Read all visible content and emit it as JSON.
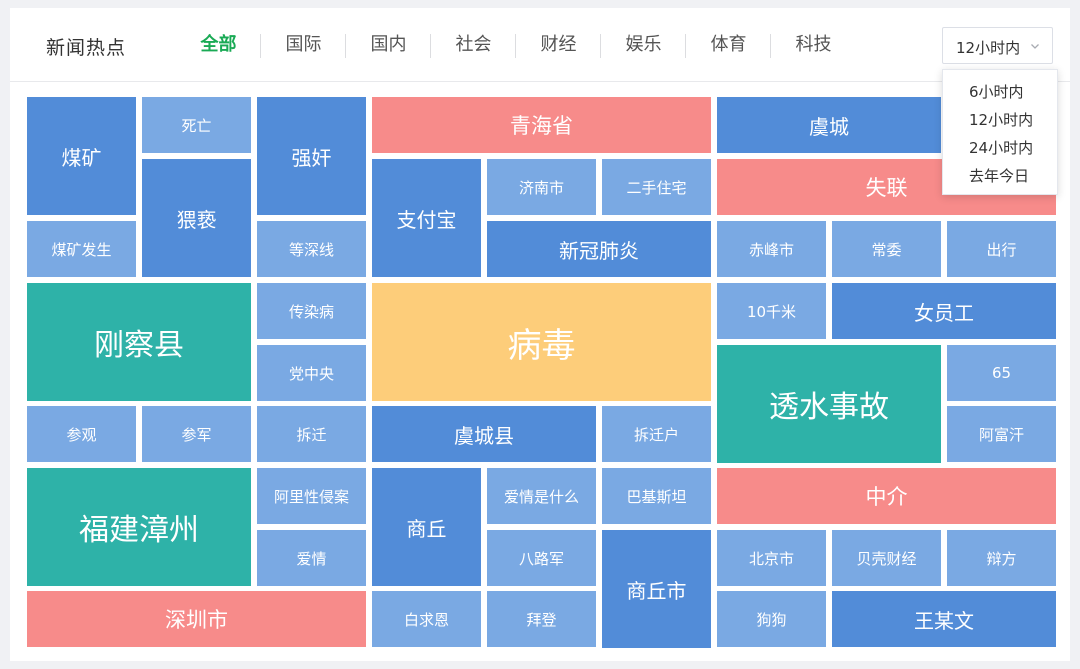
{
  "header": {
    "title": "新闻热点"
  },
  "tabs": [
    {
      "label": "全部",
      "active": true
    },
    {
      "label": "国际",
      "active": false
    },
    {
      "label": "国内",
      "active": false
    },
    {
      "label": "社会",
      "active": false
    },
    {
      "label": "财经",
      "active": false
    },
    {
      "label": "娱乐",
      "active": false
    },
    {
      "label": "体育",
      "active": false
    },
    {
      "label": "科技",
      "active": false
    }
  ],
  "time_filter": {
    "selected": "12小时内",
    "icon": "chevron-down-icon",
    "options": [
      "6小时内",
      "12小时内",
      "24小时内",
      "去年今日"
    ],
    "open": true
  },
  "colors": {
    "active_tab": "#1aaa55",
    "level_small": "#7aa9e3",
    "level_medium": "#528cd8",
    "level_large": "#2eb2a8",
    "level_hot": "#f78b8a",
    "level_top": "#fdcd7a"
  },
  "treemap": [
    {
      "label": "煤矿",
      "level": "medium"
    },
    {
      "label": "死亡",
      "level": "small"
    },
    {
      "label": "猥亵",
      "level": "medium"
    },
    {
      "label": "煤矿发生",
      "level": "small"
    },
    {
      "label": "强奸",
      "level": "medium"
    },
    {
      "label": "等深线",
      "level": "small"
    },
    {
      "label": "青海省",
      "level": "hot"
    },
    {
      "label": "支付宝",
      "level": "medium"
    },
    {
      "label": "济南市",
      "level": "small"
    },
    {
      "label": "二手住宅",
      "level": "small"
    },
    {
      "label": "新冠肺炎",
      "level": "medium"
    },
    {
      "label": "虞城",
      "level": "medium"
    },
    {
      "label": "失联",
      "level": "hot"
    },
    {
      "label": "赤峰市",
      "level": "small"
    },
    {
      "label": "常委",
      "level": "small"
    },
    {
      "label": "出行",
      "level": "small"
    },
    {
      "label": "刚察县",
      "level": "large"
    },
    {
      "label": "传染病",
      "level": "small"
    },
    {
      "label": "党中央",
      "level": "small"
    },
    {
      "label": "病毒",
      "level": "top"
    },
    {
      "label": "10千米",
      "level": "small"
    },
    {
      "label": "女员工",
      "level": "medium"
    },
    {
      "label": "透水事故",
      "level": "large"
    },
    {
      "label": "65",
      "level": "small"
    },
    {
      "label": "参观",
      "level": "small"
    },
    {
      "label": "参军",
      "level": "small"
    },
    {
      "label": "拆迁",
      "level": "small"
    },
    {
      "label": "虞城县",
      "level": "medium"
    },
    {
      "label": "拆迁户",
      "level": "small"
    },
    {
      "label": "阿富汗",
      "level": "small"
    },
    {
      "label": "福建漳州",
      "level": "large"
    },
    {
      "label": "阿里性侵案",
      "level": "small"
    },
    {
      "label": "爱情",
      "level": "small"
    },
    {
      "label": "商丘",
      "level": "medium"
    },
    {
      "label": "爱情是什么",
      "level": "small"
    },
    {
      "label": "巴基斯坦",
      "level": "small"
    },
    {
      "label": "八路军",
      "level": "small"
    },
    {
      "label": "商丘市",
      "level": "medium"
    },
    {
      "label": "中介",
      "level": "hot"
    },
    {
      "label": "北京市",
      "level": "small"
    },
    {
      "label": "贝壳财经",
      "level": "small"
    },
    {
      "label": "辩方",
      "level": "small"
    },
    {
      "label": "深圳市",
      "level": "hot"
    },
    {
      "label": "白求恩",
      "level": "small"
    },
    {
      "label": "拜登",
      "level": "small"
    },
    {
      "label": "狗狗",
      "level": "small"
    },
    {
      "label": "王某文",
      "level": "medium"
    }
  ]
}
